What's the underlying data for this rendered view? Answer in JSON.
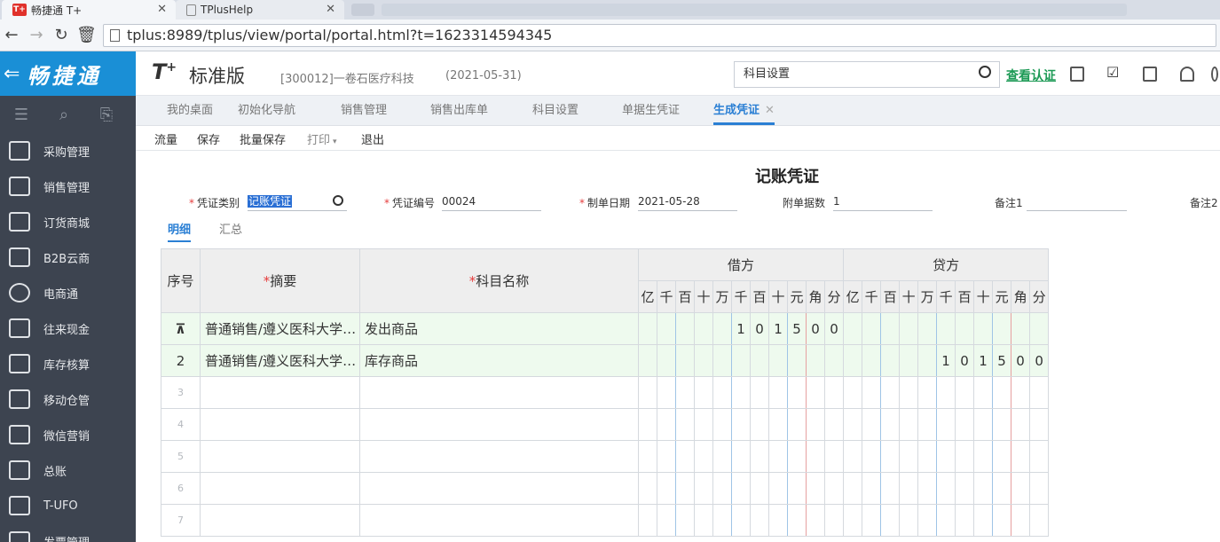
{
  "browser": {
    "tabs": [
      {
        "title": "畅捷通 T+",
        "favicon": "T+",
        "active": true
      },
      {
        "title": "TPlusHelp",
        "favicon": "page",
        "active": false
      }
    ],
    "url": "tplus:8989/tplus/view/portal/portal.html?t=1623314594345"
  },
  "sidebar": {
    "brand": "畅捷通",
    "items": [
      {
        "label": "采购管理",
        "icon": "truck-icon"
      },
      {
        "label": "销售管理",
        "icon": "chart-icon"
      },
      {
        "label": "订货商城",
        "icon": "store-icon"
      },
      {
        "label": "B2B云商",
        "icon": "bag-icon"
      },
      {
        "label": "电商通",
        "icon": "ecommerce-icon"
      },
      {
        "label": "往来现金",
        "icon": "exchange-icon"
      },
      {
        "label": "库存核算",
        "icon": "warehouse-icon"
      },
      {
        "label": "移动仓管",
        "icon": "mobile-warehouse-icon"
      },
      {
        "label": "微信营销",
        "icon": "wechat-icon"
      },
      {
        "label": "总账",
        "icon": "ledger-icon"
      },
      {
        "label": "T-UFO",
        "icon": "ufo-icon"
      },
      {
        "label": "发票管理",
        "icon": "invoice-icon"
      }
    ]
  },
  "header": {
    "logo": "T",
    "logo_sup": "+",
    "edition": "标准版",
    "company": "[300012]一卷石医疗科技",
    "date": "(2021-05-31)",
    "search_value": "科目设置",
    "verify_label": "查看认证"
  },
  "page_tabs": [
    {
      "label": "我的桌面",
      "active": false
    },
    {
      "label": "初始化导航",
      "active": false
    },
    {
      "label": "销售管理",
      "active": false
    },
    {
      "label": "销售出库单",
      "active": false
    },
    {
      "label": "科目设置",
      "active": false
    },
    {
      "label": "单据生凭证",
      "active": false
    },
    {
      "label": "生成凭证",
      "active": true,
      "close": "✕"
    }
  ],
  "toolbar": {
    "flow": "流量",
    "save": "保存",
    "batch_save": "批量保存",
    "print": "打印",
    "exit": "退出"
  },
  "voucher": {
    "title": "记账凭证",
    "fields": {
      "type_label": "凭证类别",
      "type_value": "记账凭证",
      "number_label": "凭证编号",
      "number_value": "00024",
      "date_label": "制单日期",
      "date_value": "2021-05-28",
      "attach_label": "附单据数",
      "attach_value": "1",
      "note1_label": "备注1",
      "note2_label": "备注2"
    },
    "subtabs": {
      "detail": "明细",
      "summary": "汇总"
    },
    "grid": {
      "seq_header": "序号",
      "summary_header": "摘要",
      "account_header": "科目名称",
      "debit_header": "借方",
      "credit_header": "贷方",
      "units": [
        "亿",
        "千",
        "百",
        "十",
        "万",
        "千",
        "百",
        "十",
        "元",
        "角",
        "分"
      ],
      "rows": [
        {
          "seq": "",
          "summary": "普通销售/遵义医科大学附属医院",
          "account": "发出商品",
          "debit": "101500",
          "credit": ""
        },
        {
          "seq": "2",
          "summary": "普通销售/遵义医科大学附属医院",
          "account": "库存商品",
          "debit": "",
          "credit": "101500"
        },
        {
          "seq": "3",
          "summary": "",
          "account": "",
          "debit": "",
          "credit": ""
        },
        {
          "seq": "4",
          "summary": "",
          "account": "",
          "debit": "",
          "credit": ""
        },
        {
          "seq": "5",
          "summary": "",
          "account": "",
          "debit": "",
          "credit": ""
        },
        {
          "seq": "6",
          "summary": "",
          "account": "",
          "debit": "",
          "credit": ""
        },
        {
          "seq": "7",
          "summary": "",
          "account": "",
          "debit": "",
          "credit": ""
        }
      ]
    }
  }
}
